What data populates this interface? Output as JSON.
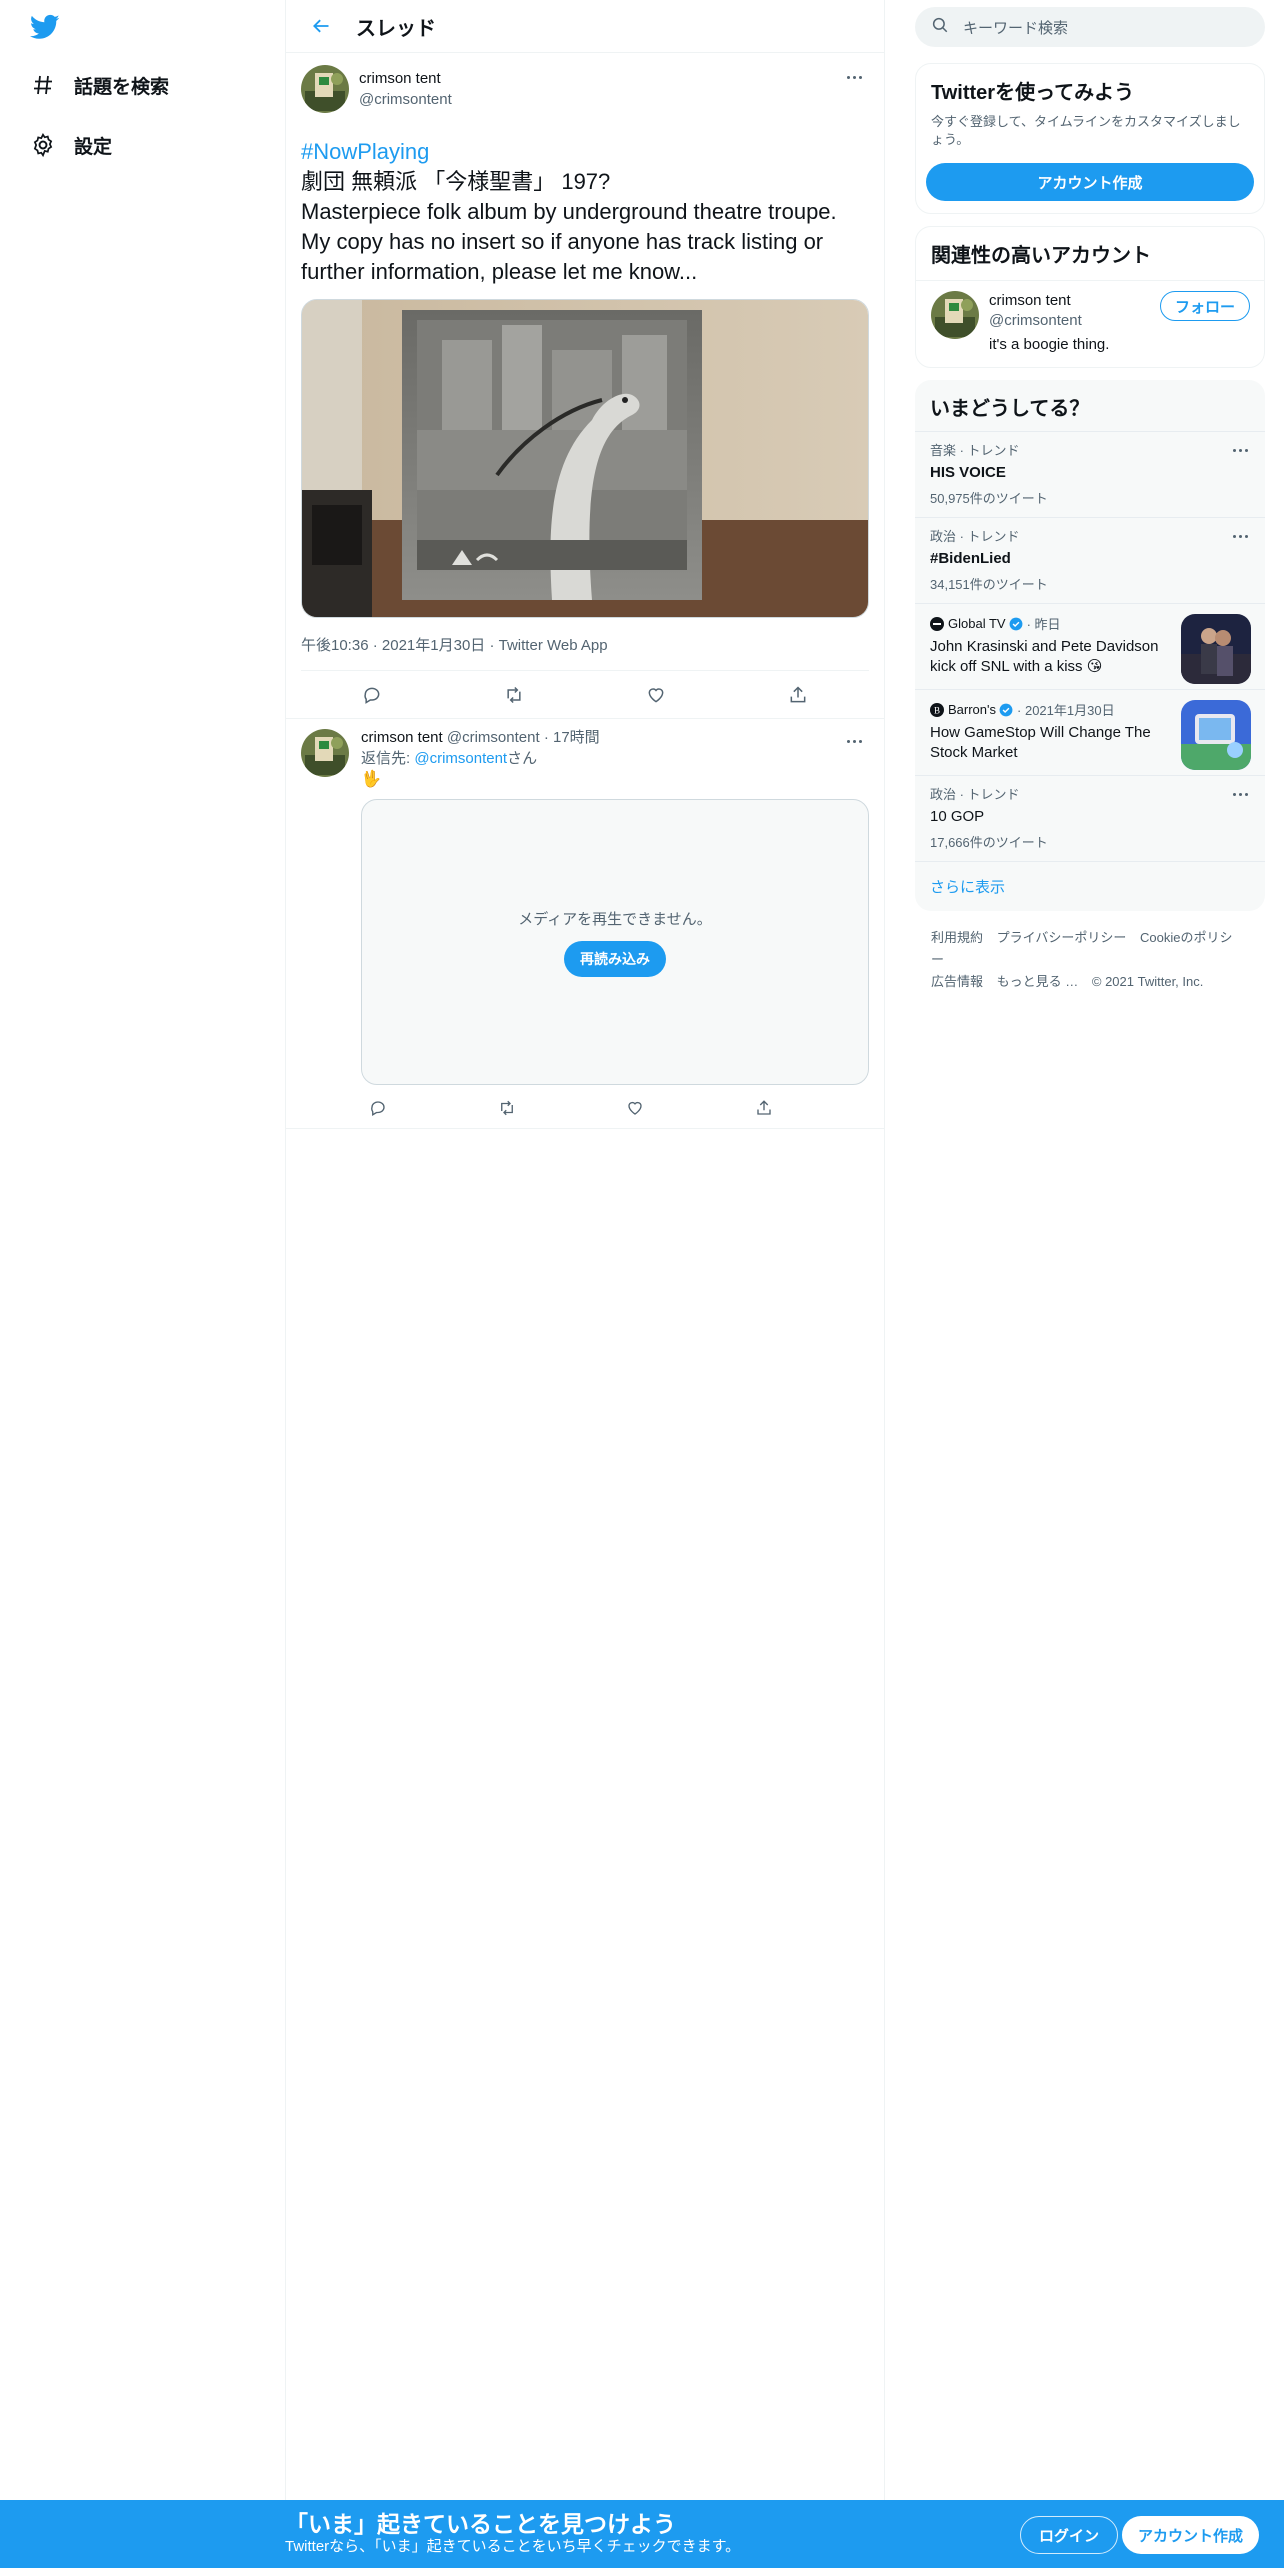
{
  "colors": {
    "accent": "#1d9bf0",
    "text": "#0f1419",
    "muted": "#536471"
  },
  "nav": {
    "logo_icon": "twitter-bird-icon",
    "items": [
      {
        "icon": "hashtag-icon",
        "label": "話題を検索"
      },
      {
        "icon": "gear-icon",
        "label": "設定"
      }
    ]
  },
  "header": {
    "title": "スレッド",
    "back_icon": "arrow-left-icon"
  },
  "main_tweet": {
    "author_name": "crimson tent",
    "author_handle": "@crimsontent",
    "hashtag": "#NowPlaying",
    "line2": "劇団 無頼派 「今様聖書」 197?",
    "body": "Masterpiece folk album by underground theatre troupe. My copy has no insert so if anyone has track listing or further information, please let me know...",
    "time": "午後10:36",
    "date": "2021年1月30日",
    "client": "Twitter Web App",
    "actions": [
      "reply-icon",
      "retweet-icon",
      "like-icon",
      "share-icon"
    ]
  },
  "reply": {
    "author_name": "crimson tent",
    "author_handle": "@crimsontent",
    "time": "17時間",
    "reply_prefix": "返信先: ",
    "reply_mention": "@crimsontent",
    "reply_suffix": "さん",
    "emoji": "🖖",
    "media_message": "メディアを再生できません。",
    "reload_label": "再読み込み"
  },
  "search": {
    "placeholder": "キーワード検索"
  },
  "signup_card": {
    "title": "Twitterを使ってみよう",
    "subtitle": "今すぐ登録して、タイムラインをカスタマイズしましょう。",
    "button": "アカウント作成"
  },
  "related": {
    "title": "関連性の高いアカウント",
    "name": "crimson tent",
    "handle": "@crimsontent",
    "bio": "it's a boogie thing.",
    "follow": "フォロー"
  },
  "trends": {
    "title": "いまどうしてる？",
    "items": [
      {
        "context": "音楽 · トレンド",
        "name": "HIS VOICE",
        "count": "50,975件のツイート"
      },
      {
        "context": "政治 · トレンド",
        "name": "#BidenLied",
        "count": "34,151件のツイート"
      }
    ],
    "news": [
      {
        "source": "Global TV",
        "time": "昨日",
        "headline": "John Krasinski and Pete Davidson kick off SNL with a kiss 😘"
      },
      {
        "source": "Barron's",
        "time": "2021年1月30日",
        "headline": "How GameStop Will Change The Stock Market"
      }
    ],
    "last": {
      "context": "政治 · トレンド",
      "name": "10 GOP",
      "count": "17,666件のツイート"
    },
    "show_more": "さらに表示"
  },
  "footer": {
    "links": [
      "利用規約",
      "プライバシーポリシー",
      "Cookieのポリシー",
      "広告情報",
      "もっと見る …",
      "© 2021 Twitter, Inc."
    ]
  },
  "bottom_bar": {
    "title": "「いま」起きていることを見つけよう",
    "subtitle": "Twitterなら、「いま」起きていることをいち早くチェックできます。",
    "login": "ログイン",
    "signup": "アカウント作成"
  }
}
